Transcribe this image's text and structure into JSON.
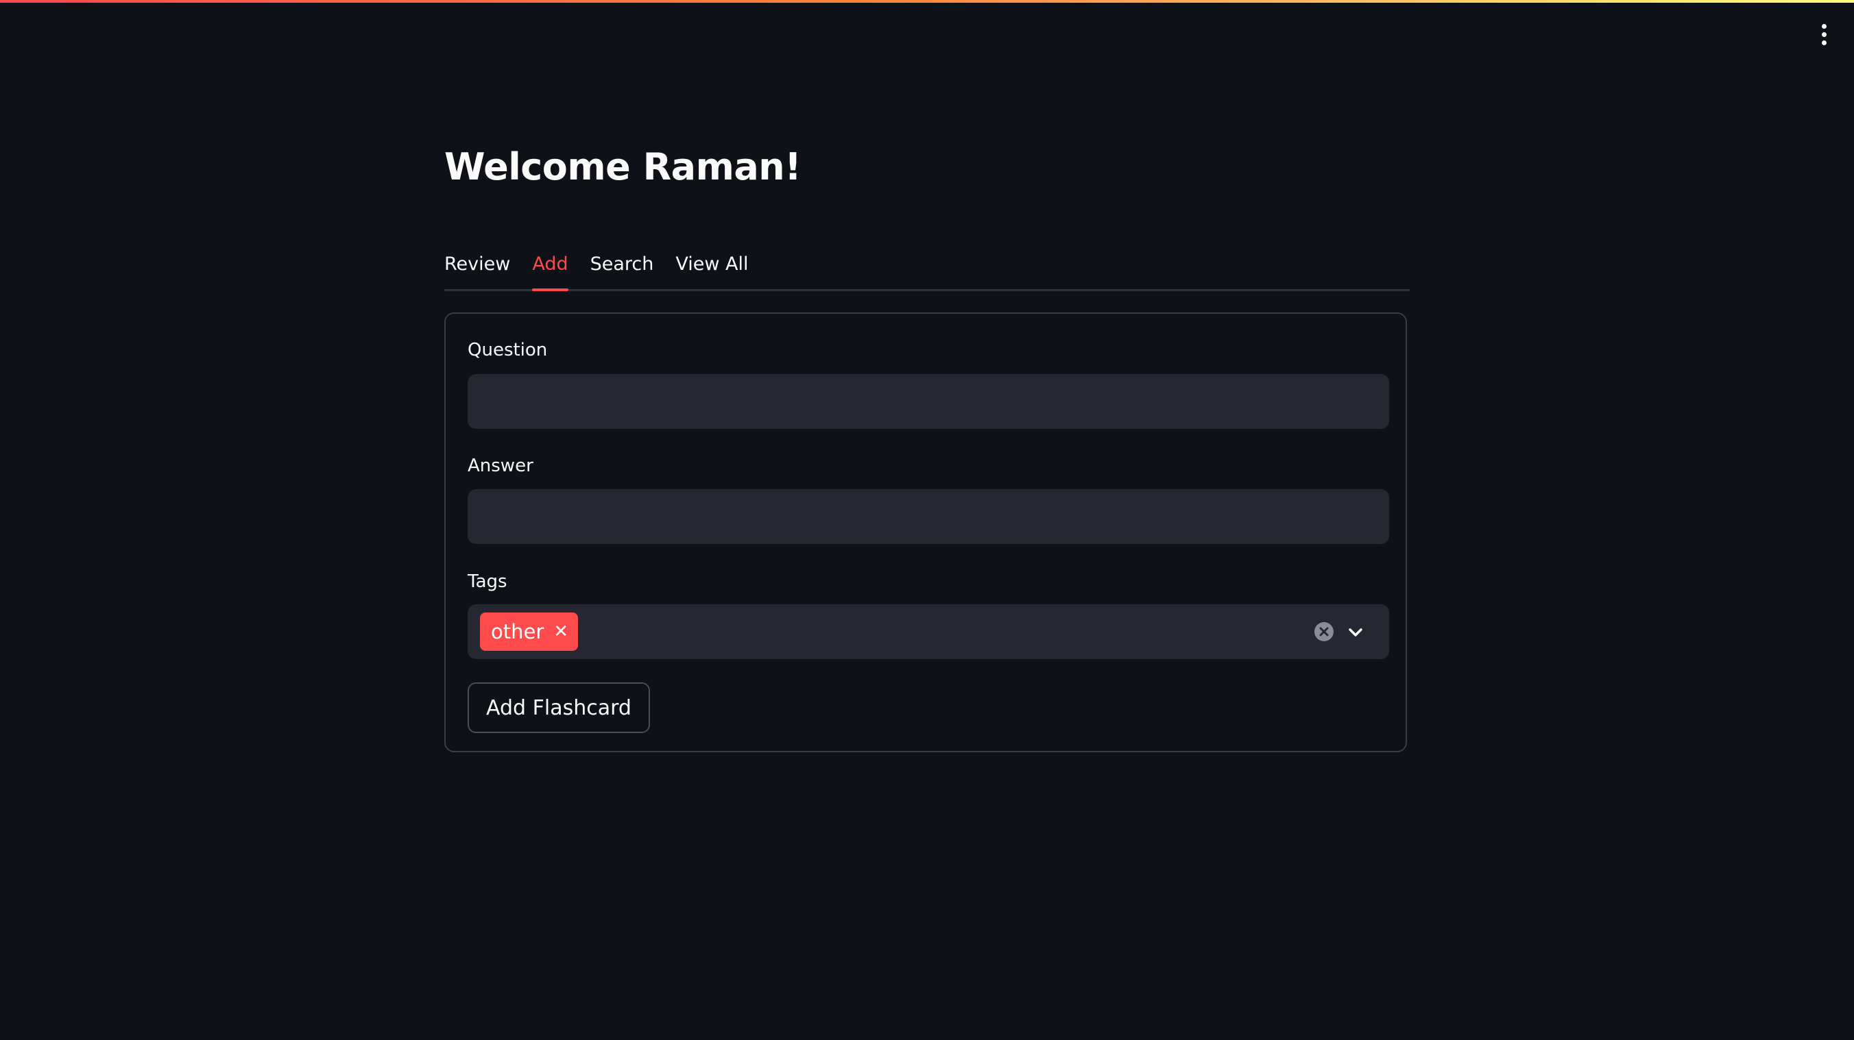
{
  "header": {
    "menu_icon": "kebab-menu-icon"
  },
  "page": {
    "title": "Welcome Raman!"
  },
  "tabs": [
    {
      "label": "Review",
      "active": false
    },
    {
      "label": "Add",
      "active": true
    },
    {
      "label": "Search",
      "active": false
    },
    {
      "label": "View All",
      "active": false
    }
  ],
  "form": {
    "question": {
      "label": "Question",
      "value": "",
      "placeholder": ""
    },
    "answer": {
      "label": "Answer",
      "value": "",
      "placeholder": ""
    },
    "tags": {
      "label": "Tags",
      "selected": [
        "other"
      ],
      "remove_icon": "close-icon",
      "clear_icon": "clear-circle-icon",
      "dropdown_icon": "chevron-down-icon"
    },
    "submit_label": "Add Flashcard"
  },
  "colors": {
    "background": "#0e1117",
    "accent": "#ff4b4b",
    "input_background": "#262730",
    "text": "#fafafa"
  }
}
